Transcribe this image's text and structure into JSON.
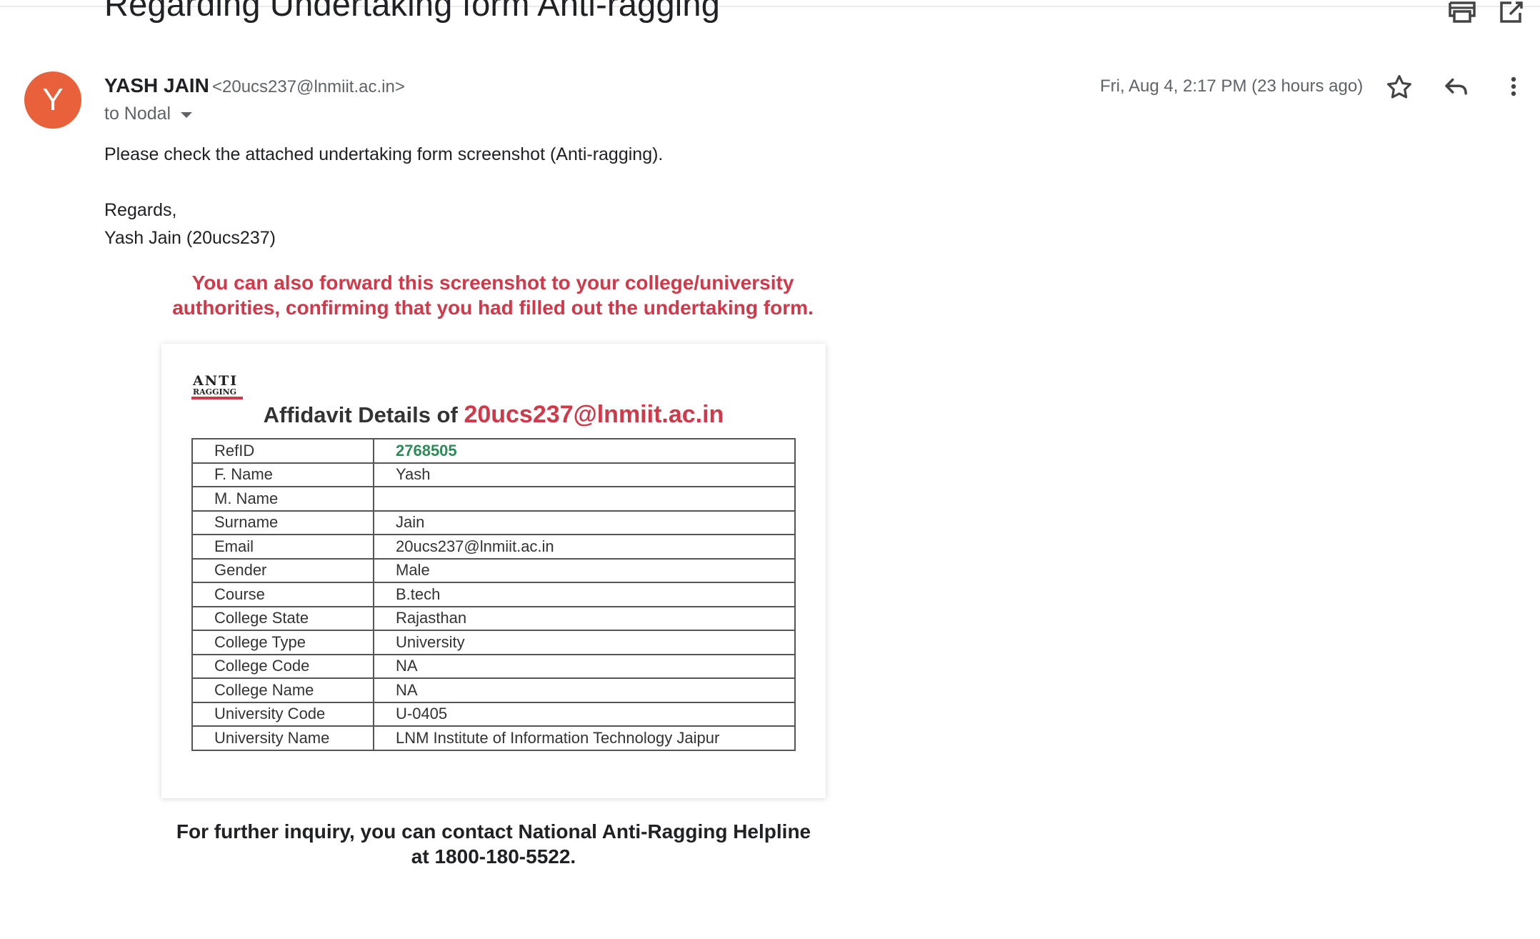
{
  "email": {
    "subject": "Regarding Undertaking form Anti-ragging",
    "sender": {
      "name": "YASH JAIN",
      "email": "<20ucs237@lnmiit.ac.in>",
      "avatar_letter": "Y",
      "avatar_color": "#e8613a"
    },
    "recipient": "to Nodal",
    "date": "Fri, Aug 4, 2:17 PM (23 hours ago)",
    "body": {
      "line1": "Please check the attached undertaking form screenshot (Anti-ragging).",
      "regards": "Regards,",
      "signature": "Yash Jain (20ucs237)"
    },
    "icons": [
      "print-icon",
      "open-in-new-window-icon",
      "star-icon",
      "reply-icon",
      "more-vert-icon"
    ]
  },
  "attachment": {
    "notice_line1": "You can also forward this screenshot to your college/university",
    "notice_line2": "authorities, confirming that you had filled out the undertaking form.",
    "logo_text_top": "ANTI",
    "logo_text_bottom": "RAGGING",
    "title_prefix": "Affidavit Details of ",
    "title_email": "20ucs237@lnmiit.ac.in",
    "rows": [
      {
        "label": "RefID",
        "value": "2768505"
      },
      {
        "label": "F. Name",
        "value": "Yash"
      },
      {
        "label": "M. Name",
        "value": ""
      },
      {
        "label": "Surname",
        "value": "Jain"
      },
      {
        "label": "Email",
        "value": "20ucs237@lnmiit.ac.in"
      },
      {
        "label": "Gender",
        "value": "Male"
      },
      {
        "label": "Course",
        "value": "B.tech"
      },
      {
        "label": "College State",
        "value": "Rajasthan"
      },
      {
        "label": "College Type",
        "value": "University"
      },
      {
        "label": "College Code",
        "value": "NA"
      },
      {
        "label": "College Name",
        "value": "NA"
      },
      {
        "label": "University Code",
        "value": "U-0405"
      },
      {
        "label": "University Name",
        "value": "LNM Institute of Information Technology Jaipur"
      }
    ],
    "footer_line1": "For further inquiry, you can contact National Anti-Ragging Helpline",
    "footer_line2": "at 1800-180-5522.",
    "colors": {
      "accent_red": "#d0394a",
      "ref_green": "#2e8b57"
    }
  }
}
